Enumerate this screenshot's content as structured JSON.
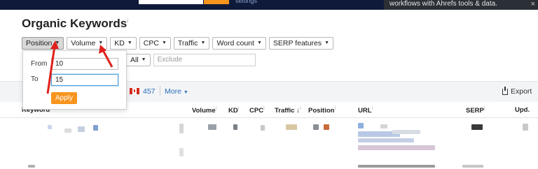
{
  "toast": {
    "text": "workflows with Ahrefs tools & data.",
    "close": "×"
  },
  "topbar": {
    "settings": "settings"
  },
  "title": "Organic Keywords",
  "title_info": "i",
  "filters": [
    {
      "label": "Position",
      "active": true
    },
    {
      "label": "Volume",
      "active": false
    },
    {
      "label": "KD",
      "active": false
    },
    {
      "label": "CPC",
      "active": false
    },
    {
      "label": "Traffic",
      "active": false
    },
    {
      "label": "Word count",
      "active": false
    },
    {
      "label": "SERP features",
      "active": false
    }
  ],
  "row2": {
    "all_label": "All",
    "exclude_placeholder": "Exclude"
  },
  "popup": {
    "from_label": "From",
    "from_value": "10",
    "to_label": "To",
    "to_value": "15",
    "apply_label": "Apply"
  },
  "band": {
    "count": "457",
    "more": "More",
    "export": "Export"
  },
  "columns": [
    {
      "label": "Keyword",
      "info": ""
    },
    {
      "label": "Volume",
      "info": "i"
    },
    {
      "label": "KD",
      "info": "i"
    },
    {
      "label": "CPC",
      "info": "i"
    },
    {
      "label": "Traffic ↓",
      "info": "i"
    },
    {
      "label": "Position",
      "info": "i"
    },
    {
      "label": "URL",
      "info": "i"
    },
    {
      "label": "SERP",
      "info": "i"
    },
    {
      "label": "Upd.",
      "info": ""
    }
  ],
  "colors": {
    "accent_orange": "#f7941d",
    "link_blue": "#2a6ebb",
    "arrow_red": "#e0201b",
    "topbar": "#0f1a3a"
  }
}
